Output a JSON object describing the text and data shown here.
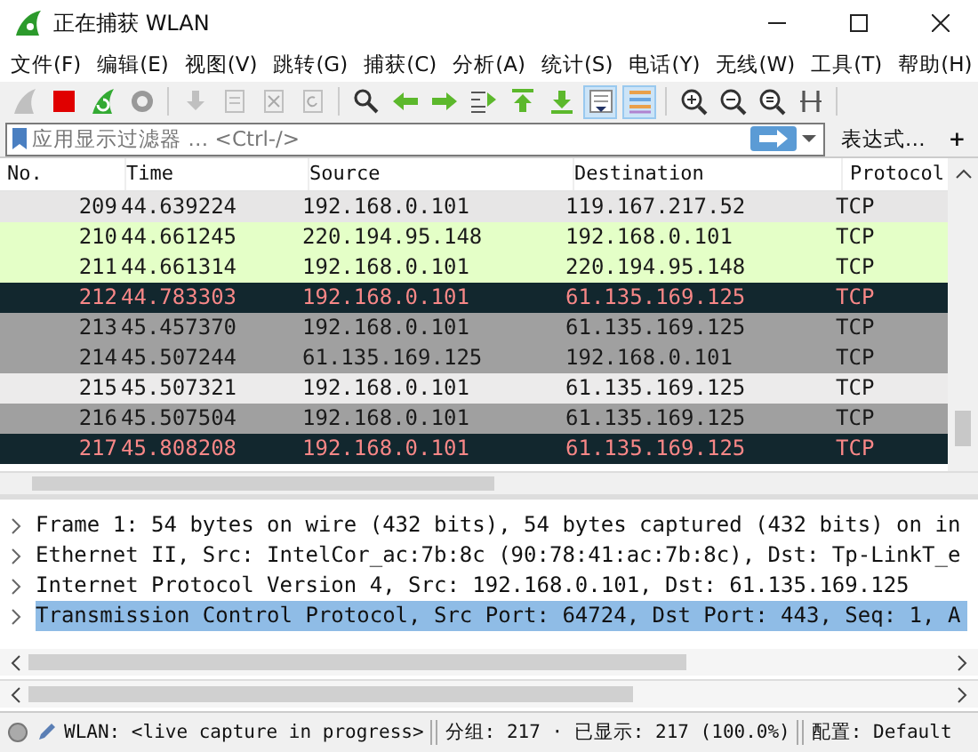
{
  "window": {
    "title": "正在捕获 WLAN"
  },
  "menu": [
    "文件(F)",
    "编辑(E)",
    "视图(V)",
    "跳转(G)",
    "捕获(C)",
    "分析(A)",
    "统计(S)",
    "电话(Y)",
    "无线(W)",
    "工具(T)",
    "帮助(H)"
  ],
  "toolbar": [
    {
      "kind": "fin",
      "disabled": true,
      "on": false
    },
    {
      "kind": "stop",
      "disabled": false,
      "on": false
    },
    {
      "kind": "restart",
      "disabled": false,
      "on": false
    },
    {
      "kind": "gear",
      "disabled": false,
      "on": false
    },
    {
      "kind": "open",
      "disabled": true,
      "on": false
    },
    {
      "kind": "doc",
      "disabled": true,
      "on": false
    },
    {
      "kind": "close",
      "disabled": true,
      "on": false
    },
    {
      "kind": "reload",
      "disabled": true,
      "on": false
    },
    {
      "kind": "find",
      "disabled": false,
      "on": false
    },
    {
      "kind": "back",
      "disabled": false,
      "on": false
    },
    {
      "kind": "forward",
      "disabled": false,
      "on": false
    },
    {
      "kind": "goto",
      "disabled": false,
      "on": false
    },
    {
      "kind": "first",
      "disabled": false,
      "on": false
    },
    {
      "kind": "last",
      "disabled": false,
      "on": false
    },
    {
      "kind": "autoscroll",
      "disabled": false,
      "on": true
    },
    {
      "kind": "colorize",
      "disabled": false,
      "on": true
    },
    {
      "kind": "zoom-in",
      "disabled": false,
      "on": false
    },
    {
      "kind": "zoom-out",
      "disabled": false,
      "on": false
    },
    {
      "kind": "zoom-normal",
      "disabled": false,
      "on": false
    },
    {
      "kind": "resize",
      "disabled": false,
      "on": false
    }
  ],
  "filter": {
    "placeholder": "应用显示过滤器 … <Ctrl-/>",
    "expression": "表达式…",
    "add": "+"
  },
  "table": {
    "columns": [
      "No.",
      "Time",
      "Source",
      "Destination",
      "Protocol"
    ],
    "rows": [
      {
        "no": "209",
        "time": "44.639224",
        "source": "192.168.0.101",
        "destination": "119.167.217.52",
        "protocol": "TCP",
        "color": "#e7e6e6"
      },
      {
        "no": "210",
        "time": "44.661245",
        "source": "220.194.95.148",
        "destination": "192.168.0.101",
        "protocol": "TCP",
        "color": "#e4ffc7"
      },
      {
        "no": "211",
        "time": "44.661314",
        "source": "192.168.0.101",
        "destination": "220.194.95.148",
        "protocol": "TCP",
        "color": "#e4ffc7"
      },
      {
        "no": "212",
        "time": "44.783303",
        "source": "192.168.0.101",
        "destination": "61.135.169.125",
        "protocol": "TCP",
        "color": "#12272e"
      },
      {
        "no": "213",
        "time": "45.457370",
        "source": "192.168.0.101",
        "destination": "61.135.169.125",
        "protocol": "TCP",
        "color": "#a0a0a0"
      },
      {
        "no": "214",
        "time": "45.507244",
        "source": "61.135.169.125",
        "destination": "192.168.0.101",
        "protocol": "TCP",
        "color": "#a0a0a0"
      },
      {
        "no": "215",
        "time": "45.507321",
        "source": "192.168.0.101",
        "destination": "61.135.169.125",
        "protocol": "TCP",
        "color": "#ecebeb"
      },
      {
        "no": "216",
        "time": "45.507504",
        "source": "192.168.0.101",
        "destination": "61.135.169.125",
        "protocol": "TCP",
        "color": "#a0a0a0"
      },
      {
        "no": "217",
        "time": "45.808208",
        "source": "192.168.0.101",
        "destination": "61.135.169.125",
        "protocol": "TCP",
        "color": "#12272e"
      }
    ]
  },
  "details": [
    {
      "text": "Frame 1: 54 bytes on wire (432 bits), 54 bytes captured (432 bits) on in",
      "expanded": false,
      "selected": false
    },
    {
      "text": "Ethernet II, Src: IntelCor_ac:7b:8c (90:78:41:ac:7b:8c), Dst: Tp-LinkT_e",
      "expanded": false,
      "selected": false
    },
    {
      "text": "Internet Protocol Version 4, Src: 192.168.0.101, Dst: 61.135.169.125",
      "expanded": false,
      "selected": false
    },
    {
      "text": "Transmission Control Protocol, Src Port: 64724, Dst Port: 443, Seq: 1, A",
      "expanded": false,
      "selected": true
    }
  ],
  "status_bar": {
    "capture": "WLAN: <live capture in progress>",
    "packets": "分组: 217 · 已显示: 217 (100.0%)",
    "profile": "配置: Default"
  }
}
